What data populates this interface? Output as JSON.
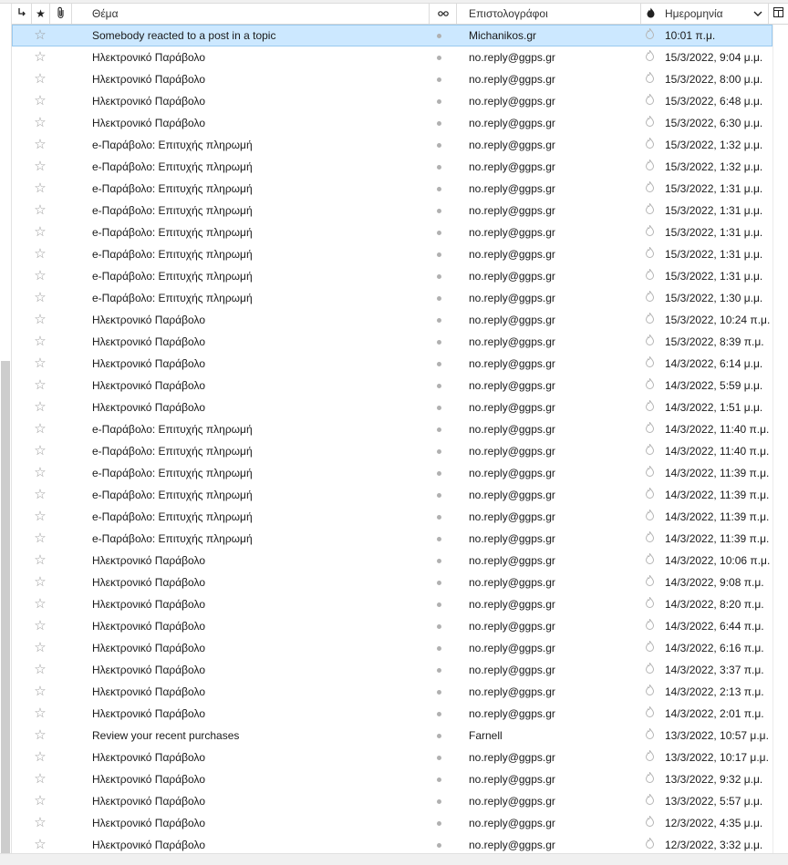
{
  "header": {
    "thread_icon": "thread-icon",
    "star_icon": "star-icon",
    "attachment_icon": "paperclip-icon",
    "subject_label": "Θέμα",
    "read_icon": "read-status-icon",
    "sender_label": "Επιστολογράφοι",
    "junk_icon": "junk-flame-icon",
    "date_label": "Ημερομηνία",
    "column_picker_icon": "column-picker-icon"
  },
  "colors": {
    "selected_bg": "#cce8ff",
    "selected_border": "#99c9ef"
  },
  "messages": [
    {
      "subject": "Somebody reacted to a post in a topic",
      "sender": "Michanikos.gr",
      "date": "10:01 π.μ."
    },
    {
      "subject": "Ηλεκτρονικό Παράβολο",
      "sender": "no.reply@ggps.gr",
      "date": "15/3/2022, 9:04 μ.μ."
    },
    {
      "subject": "Ηλεκτρονικό Παράβολο",
      "sender": "no.reply@ggps.gr",
      "date": "15/3/2022, 8:00 μ.μ."
    },
    {
      "subject": "Ηλεκτρονικό Παράβολο",
      "sender": "no.reply@ggps.gr",
      "date": "15/3/2022, 6:48 μ.μ."
    },
    {
      "subject": "Ηλεκτρονικό Παράβολο",
      "sender": "no.reply@ggps.gr",
      "date": "15/3/2022, 6:30 μ.μ."
    },
    {
      "subject": "e-Παράβολο: Επιτυχής πληρωμή",
      "sender": "no.reply@ggps.gr",
      "date": "15/3/2022, 1:32 μ.μ."
    },
    {
      "subject": "e-Παράβολο: Επιτυχής πληρωμή",
      "sender": "no.reply@ggps.gr",
      "date": "15/3/2022, 1:32 μ.μ."
    },
    {
      "subject": "e-Παράβολο: Επιτυχής πληρωμή",
      "sender": "no.reply@ggps.gr",
      "date": "15/3/2022, 1:31 μ.μ."
    },
    {
      "subject": "e-Παράβολο: Επιτυχής πληρωμή",
      "sender": "no.reply@ggps.gr",
      "date": "15/3/2022, 1:31 μ.μ."
    },
    {
      "subject": "e-Παράβολο: Επιτυχής πληρωμή",
      "sender": "no.reply@ggps.gr",
      "date": "15/3/2022, 1:31 μ.μ."
    },
    {
      "subject": "e-Παράβολο: Επιτυχής πληρωμή",
      "sender": "no.reply@ggps.gr",
      "date": "15/3/2022, 1:31 μ.μ."
    },
    {
      "subject": "e-Παράβολο: Επιτυχής πληρωμή",
      "sender": "no.reply@ggps.gr",
      "date": "15/3/2022, 1:31 μ.μ."
    },
    {
      "subject": "e-Παράβολο: Επιτυχής πληρωμή",
      "sender": "no.reply@ggps.gr",
      "date": "15/3/2022, 1:30 μ.μ."
    },
    {
      "subject": "Ηλεκτρονικό Παράβολο",
      "sender": "no.reply@ggps.gr",
      "date": "15/3/2022, 10:24 π.μ."
    },
    {
      "subject": "Ηλεκτρονικό Παράβολο",
      "sender": "no.reply@ggps.gr",
      "date": "15/3/2022, 8:39 π.μ."
    },
    {
      "subject": "Ηλεκτρονικό Παράβολο",
      "sender": "no.reply@ggps.gr",
      "date": "14/3/2022, 6:14 μ.μ."
    },
    {
      "subject": "Ηλεκτρονικό Παράβολο",
      "sender": "no.reply@ggps.gr",
      "date": "14/3/2022, 5:59 μ.μ."
    },
    {
      "subject": "Ηλεκτρονικό Παράβολο",
      "sender": "no.reply@ggps.gr",
      "date": "14/3/2022, 1:51 μ.μ."
    },
    {
      "subject": "e-Παράβολο: Επιτυχής πληρωμή",
      "sender": "no.reply@ggps.gr",
      "date": "14/3/2022, 11:40 π.μ."
    },
    {
      "subject": "e-Παράβολο: Επιτυχής πληρωμή",
      "sender": "no.reply@ggps.gr",
      "date": "14/3/2022, 11:40 π.μ."
    },
    {
      "subject": "e-Παράβολο: Επιτυχής πληρωμή",
      "sender": "no.reply@ggps.gr",
      "date": "14/3/2022, 11:39 π.μ."
    },
    {
      "subject": "e-Παράβολο: Επιτυχής πληρωμή",
      "sender": "no.reply@ggps.gr",
      "date": "14/3/2022, 11:39 π.μ."
    },
    {
      "subject": "e-Παράβολο: Επιτυχής πληρωμή",
      "sender": "no.reply@ggps.gr",
      "date": "14/3/2022, 11:39 π.μ."
    },
    {
      "subject": "e-Παράβολο: Επιτυχής πληρωμή",
      "sender": "no.reply@ggps.gr",
      "date": "14/3/2022, 11:39 π.μ."
    },
    {
      "subject": "Ηλεκτρονικό Παράβολο",
      "sender": "no.reply@ggps.gr",
      "date": "14/3/2022, 10:06 π.μ."
    },
    {
      "subject": "Ηλεκτρονικό Παράβολο",
      "sender": "no.reply@ggps.gr",
      "date": "14/3/2022, 9:08 π.μ."
    },
    {
      "subject": "Ηλεκτρονικό Παράβολο",
      "sender": "no.reply@ggps.gr",
      "date": "14/3/2022, 8:20 π.μ."
    },
    {
      "subject": "Ηλεκτρονικό Παράβολο",
      "sender": "no.reply@ggps.gr",
      "date": "14/3/2022, 6:44 π.μ."
    },
    {
      "subject": "Ηλεκτρονικό Παράβολο",
      "sender": "no.reply@ggps.gr",
      "date": "14/3/2022, 6:16 π.μ."
    },
    {
      "subject": "Ηλεκτρονικό Παράβολο",
      "sender": "no.reply@ggps.gr",
      "date": "14/3/2022, 3:37 π.μ."
    },
    {
      "subject": "Ηλεκτρονικό Παράβολο",
      "sender": "no.reply@ggps.gr",
      "date": "14/3/2022, 2:13 π.μ."
    },
    {
      "subject": "Ηλεκτρονικό Παράβολο",
      "sender": "no.reply@ggps.gr",
      "date": "14/3/2022, 2:01 π.μ."
    },
    {
      "subject": "Review your recent purchases",
      "sender": "Farnell",
      "date": "13/3/2022, 10:57 μ.μ."
    },
    {
      "subject": "Ηλεκτρονικό Παράβολο",
      "sender": "no.reply@ggps.gr",
      "date": "13/3/2022, 10:17 μ.μ."
    },
    {
      "subject": "Ηλεκτρονικό Παράβολο",
      "sender": "no.reply@ggps.gr",
      "date": "13/3/2022, 9:32 μ.μ."
    },
    {
      "subject": "Ηλεκτρονικό Παράβολο",
      "sender": "no.reply@ggps.gr",
      "date": "13/3/2022, 5:57 μ.μ."
    },
    {
      "subject": "Ηλεκτρονικό Παράβολο",
      "sender": "no.reply@ggps.gr",
      "date": "12/3/2022, 4:35 μ.μ."
    },
    {
      "subject": "Ηλεκτρονικό Παράβολο",
      "sender": "no.reply@ggps.gr",
      "date": "12/3/2022, 3:32 μ.μ."
    }
  ]
}
